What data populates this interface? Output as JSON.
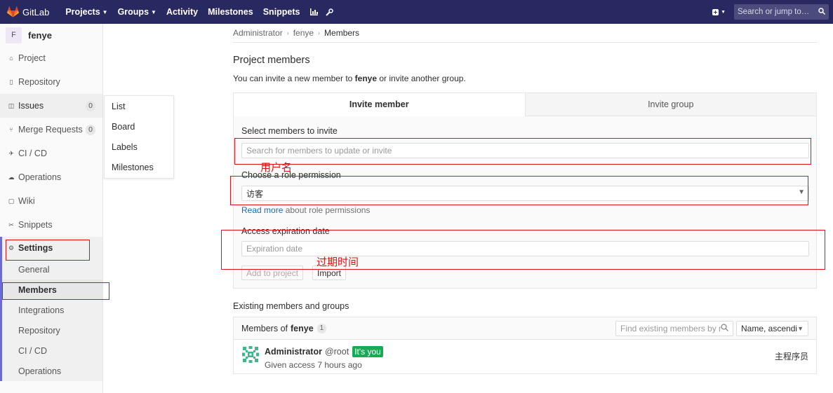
{
  "navbar": {
    "brand": "GitLab",
    "items": [
      {
        "label": "Projects",
        "has_caret": true
      },
      {
        "label": "Groups",
        "has_caret": true
      },
      {
        "label": "Activity",
        "has_caret": false
      },
      {
        "label": "Milestones",
        "has_caret": false
      },
      {
        "label": "Snippets",
        "has_caret": false
      }
    ],
    "search_placeholder": "Search or jump to…",
    "bg_color": "#292961"
  },
  "sidebar": {
    "project_avatar_letter": "F",
    "project_name": "fenye",
    "items": [
      {
        "label": "Project",
        "icon": "home-icon"
      },
      {
        "label": "Repository",
        "icon": "doc-icon"
      },
      {
        "label": "Issues",
        "icon": "issues-icon",
        "count": "0"
      },
      {
        "label": "Merge Requests",
        "icon": "merge-icon",
        "count": "0"
      },
      {
        "label": "CI / CD",
        "icon": "rocket-icon"
      },
      {
        "label": "Operations",
        "icon": "cloud-icon"
      },
      {
        "label": "Wiki",
        "icon": "book-icon"
      },
      {
        "label": "Snippets",
        "icon": "scissors-icon"
      }
    ],
    "settings": {
      "label": "Settings",
      "sub_items": [
        "General",
        "Members",
        "Integrations",
        "Repository",
        "CI / CD",
        "Operations"
      ]
    }
  },
  "issues_flyout": [
    "List",
    "Board",
    "Labels",
    "Milestones"
  ],
  "breadcrumb": [
    "Administrator",
    "fenye",
    "Members"
  ],
  "page": {
    "title": "Project members",
    "intro_before": "You can invite a new member to ",
    "intro_project": "fenye",
    "intro_after": " or invite another group."
  },
  "invite": {
    "tab_member": "Invite member",
    "tab_group": "Invite group",
    "select_label": "Select members to invite",
    "select_placeholder": "Search for members to update or invite",
    "role_label": "Choose a role permission",
    "role_value": "访客",
    "read_more": "Read more",
    "read_more_rest": " about role permissions",
    "expiry_label": "Access expiration date",
    "expiry_placeholder": "Expiration date",
    "add_button": "Add to project",
    "import_button": "Import"
  },
  "existing": {
    "title": "Existing members and groups",
    "members_of": "Members of",
    "project": "fenye",
    "count": "1",
    "filter_placeholder": "Find existing members by name",
    "sort_label": "Name, ascending",
    "members": [
      {
        "name": "Administrator",
        "username": "@root",
        "badge": "It's you",
        "access": "Given access 7 hours ago",
        "role": "主程序员"
      }
    ]
  },
  "annotations": {
    "username_note": "用户名",
    "expiry_note": "过期时间",
    "color": "#e01010"
  }
}
